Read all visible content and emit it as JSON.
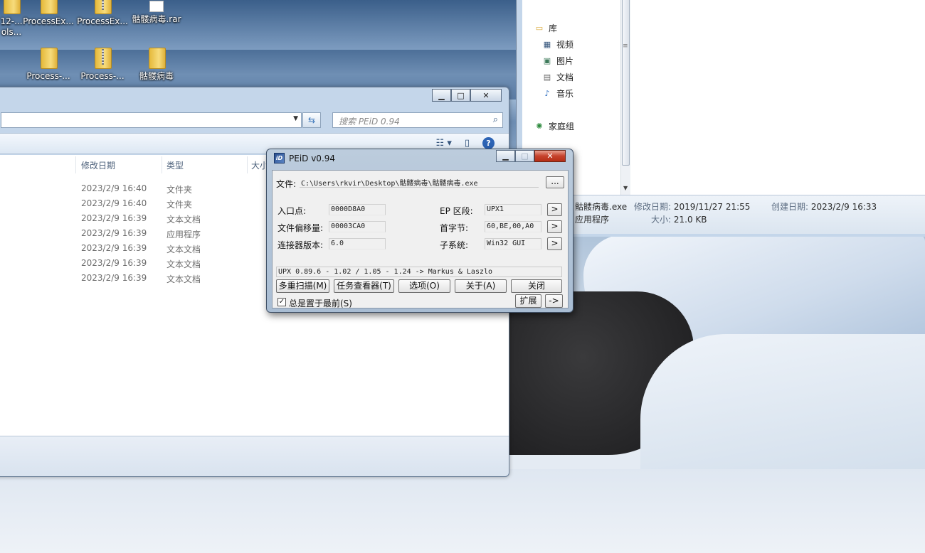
{
  "desktop": {
    "icons_row1": [
      {
        "label": "12-...\nols...",
        "kind": "folder"
      },
      {
        "label": "ProcessEx...",
        "kind": "folder"
      },
      {
        "label": "ProcessEx...",
        "kind": "zip"
      },
      {
        "label": "骷髅病毒.rar",
        "kind": "file"
      }
    ],
    "icons_row2": [
      {
        "label": "Process-...",
        "kind": "folder"
      },
      {
        "label": "Process-...",
        "kind": "zip"
      },
      {
        "label": "骷髅病毒",
        "kind": "folder"
      }
    ]
  },
  "explorer": {
    "search_placeholder": "搜索 PEiD 0.94",
    "columns": {
      "date": "修改日期",
      "type": "类型",
      "size": "大小"
    },
    "rows": [
      {
        "date": "2023/2/9 16:40",
        "type": "文件夹"
      },
      {
        "date": "2023/2/9 16:40",
        "type": "文件夹"
      },
      {
        "date": "2023/2/9 16:39",
        "type": "文本文档"
      },
      {
        "date": "2023/2/9 16:39",
        "type": "应用程序"
      },
      {
        "date": "2023/2/9 16:39",
        "type": "文本文档"
      },
      {
        "date": "2023/2/9 16:39",
        "type": "文本文档"
      },
      {
        "date": "2023/2/9 16:39",
        "type": "文本文档"
      }
    ]
  },
  "right_window": {
    "nav": {
      "library": "库",
      "videos": "视频",
      "pictures": "图片",
      "documents": "文档",
      "music": "音乐",
      "homegroup": "家庭组"
    },
    "details": {
      "filename": "骷髅病毒.exe",
      "modified_label": "修改日期:",
      "modified_value": "2019/11/27 21:55",
      "created_label": "创建日期:",
      "created_value": "2023/2/9 16:33",
      "type": "应用程序",
      "size_label": "大小:",
      "size_value": "21.0 KB"
    }
  },
  "peid": {
    "title": "PEiD v0.94",
    "file_label": "文件:",
    "file_path": "C:\\Users\\rkvir\\Desktop\\骷髅病毒\\骷髅病毒.exe",
    "browse_label": "...",
    "entry_point_label": "入口点:",
    "entry_point": "0000D8A0",
    "file_offset_label": "文件偏移量:",
    "file_offset": "00003CA0",
    "linker_label": "连接器版本:",
    "linker_version": "6.0",
    "ep_section_label": "EP 区段:",
    "ep_section": "UPX1",
    "first_bytes_label": "首字节:",
    "first_bytes": "60,BE,00,A0",
    "subsystem_label": "子系统:",
    "subsystem": "Win32 GUI",
    "arrow": ">",
    "detection": "UPX 0.89.6 - 1.02 / 1.05 - 1.24 -> Markus & Laszlo",
    "buttons": {
      "multiscan": "多重扫描(M)",
      "task_viewer": "任务查看器(T)",
      "options": "选项(O)",
      "about": "关于(A)",
      "close": "关闭",
      "extend": "扩展",
      "more": "->"
    },
    "stay_on_top": "总是置于最前(S)",
    "stay_on_top_checked": true
  }
}
